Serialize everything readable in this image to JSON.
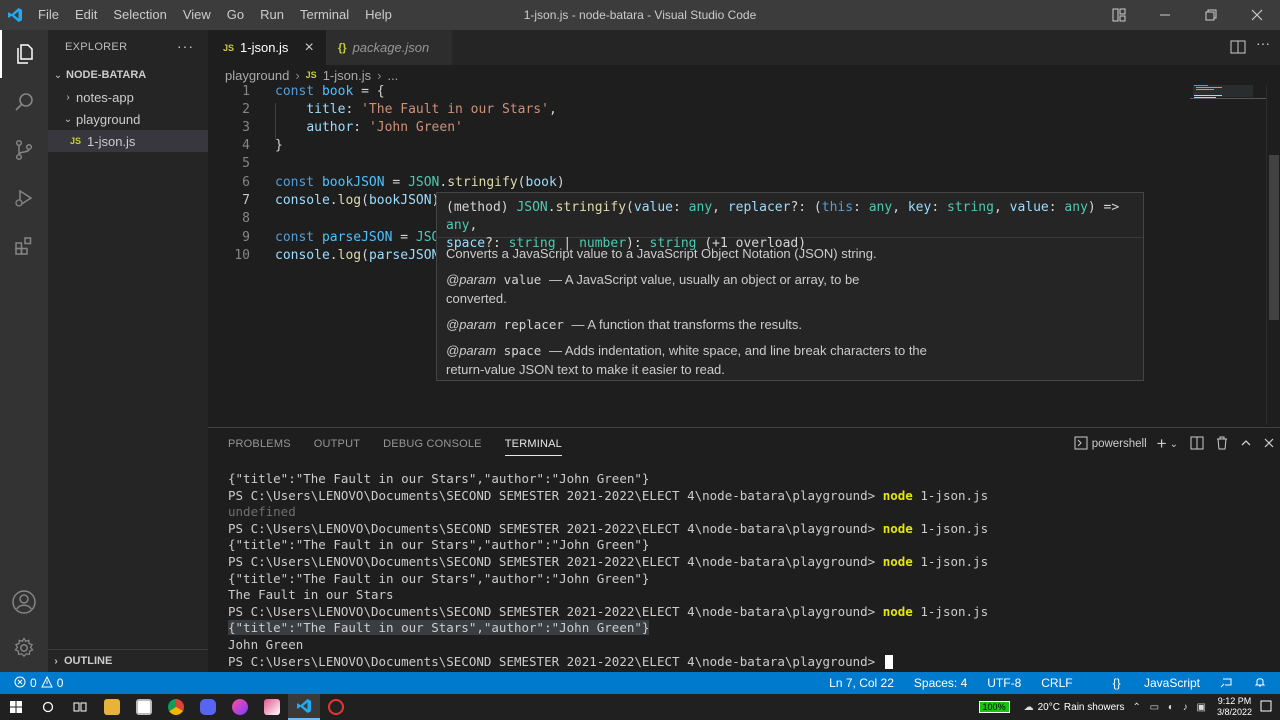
{
  "window": {
    "title": "1-json.js - node-batara - Visual Studio Code",
    "menu": [
      "File",
      "Edit",
      "Selection",
      "View",
      "Go",
      "Run",
      "Terminal",
      "Help"
    ]
  },
  "sidebar": {
    "header": "EXPLORER",
    "more": "···",
    "root": "NODE-BATARA",
    "items": [
      {
        "label": "notes-app",
        "type": "folder",
        "expanded": false
      },
      {
        "label": "playground",
        "type": "folder",
        "expanded": true
      },
      {
        "label": "1-json.js",
        "type": "file",
        "badge": "JS"
      }
    ],
    "outline": "OUTLINE"
  },
  "tabs": [
    {
      "label": "1-json.js",
      "badge": "JS",
      "active": true,
      "close": "×"
    },
    {
      "label": "package.json",
      "badge": "{}",
      "active": false
    }
  ],
  "breadcrumb": {
    "folder": "playground",
    "badge": "JS",
    "file": "1-json.js",
    "more": "..."
  },
  "editor": {
    "line_numbers": [
      "1",
      "2",
      "3",
      "4",
      "5",
      "6",
      "7",
      "8",
      "9",
      "10"
    ],
    "current_line": "7"
  },
  "hover": {
    "sig_method": "(method) ",
    "sig_json": "JSON",
    "sig_fn": "stringify",
    "sig_p1": "(",
    "sig_value": "value",
    "sig_p2": ": ",
    "sig_any1": "any",
    "sig_p3": ", ",
    "sig_replacer": "replacer",
    "sig_p4": "?: (",
    "sig_this": "this",
    "sig_p5": ": ",
    "sig_any2": "any",
    "sig_p6": ", ",
    "sig_key": "key",
    "sig_p7": ": ",
    "sig_string1": "string",
    "sig_p8": ", ",
    "sig_value2": "value",
    "sig_p9": ": ",
    "sig_any3": "any",
    "sig_p10": ") => ",
    "sig_any4": "any",
    "sig_p11": ",",
    "sig_space": "space",
    "sig_p12": "?: ",
    "sig_string2": "string",
    "sig_p13": " | ",
    "sig_number": "number",
    "sig_p14": "): ",
    "sig_string3": "string",
    "sig_p15": " (+1 overload)",
    "description": "Converts a JavaScript value to a JavaScript Object Notation (JSON) string.",
    "params": [
      {
        "tag": "@param",
        "name": "value",
        "text": "— A JavaScript value, usually an object or array, to be converted."
      },
      {
        "tag": "@param",
        "name": "replacer",
        "text": "— A function that transforms the results."
      },
      {
        "tag": "@param",
        "name": "space",
        "text": "— Adds indentation, white space, and line break characters to the return-value JSON text to make it easier to read."
      }
    ]
  },
  "panel": {
    "tabs": [
      "PROBLEMS",
      "OUTPUT",
      "DEBUG CONSOLE",
      "TERMINAL"
    ],
    "shell": "powershell",
    "terminal_prompt": "PS C:\\Users\\LENOVO\\Documents\\SECOND SEMESTER 2021-2022\\ELECT 4\\node-batara\\playground> ",
    "terminal_cmd_node": "node",
    "terminal_cmd_file": " 1-json.js",
    "terminal_json_output": "{\"title\":\"The Fault in our Stars\",\"author\":\"John Green\"}",
    "terminal_undefined": "undefined",
    "terminal_title_output": "The Fault in our Stars",
    "terminal_author_output": "John Green"
  },
  "statusbar": {
    "errors": "0",
    "warnings": "0",
    "position": "Ln 7, Col 22",
    "spaces": "Spaces: 4",
    "encoding": "UTF-8",
    "eol": "CRLF",
    "language_icon": "{}",
    "language": "JavaScript"
  },
  "taskbar": {
    "battery": "100%",
    "weather_temp": "20°C",
    "weather_text": "Rain showers",
    "time": "9:12 PM",
    "date": "3/8/2022"
  },
  "colors": {
    "accent": "#007acc",
    "keyword": "#569cd6",
    "string": "#ce9178",
    "function": "#dcdcaa",
    "variable": "#9cdcfe",
    "terminal_command": "#e5e510"
  }
}
